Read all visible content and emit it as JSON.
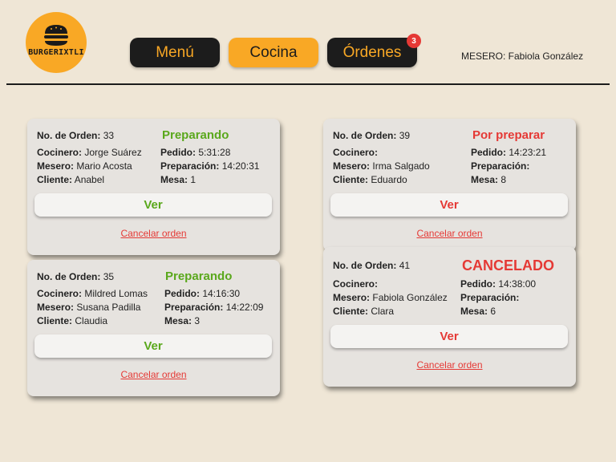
{
  "brand": {
    "name": "BURGERIXTLI"
  },
  "nav": {
    "menu_label": "Menú",
    "cocina_label": "Cocina",
    "ordenes_label": "Órdenes",
    "ordenes_badge": "3",
    "active": "Cocina"
  },
  "user": {
    "mesero_text": "MESERO: Fabiola González"
  },
  "labels": {
    "orden": "No. de Orden:",
    "cocinero": "Cocinero:",
    "mesero": "Mesero:",
    "cliente": "Cliente:",
    "pedido": "Pedido:",
    "preparacion": "Preparación:",
    "mesa": "Mesa:",
    "ver": "Ver",
    "cancelar": "Cancelar orden"
  },
  "orders": [
    {
      "numero": "33",
      "status": "Preparando",
      "cocinero": "Jorge Suárez",
      "mesero": "Mario Acosta",
      "cliente": "Anabel",
      "pedido": "5:31:28",
      "preparacion": "14:20:31",
      "mesa": "1"
    },
    {
      "numero": "35",
      "status": "Preparando",
      "cocinero": "Mildred Lomas",
      "mesero": "Susana Padilla",
      "cliente": "Claudia",
      "pedido": "14:16:30",
      "preparacion": "14:22:09",
      "mesa": "3"
    },
    {
      "numero": "39",
      "status": "Por preparar",
      "cocinero": "",
      "mesero": "Irma Salgado",
      "cliente": "Eduardo",
      "pedido": "14:23:21",
      "preparacion": "",
      "mesa": "8"
    },
    {
      "numero": "41",
      "status": "CANCELADO",
      "cocinero": "",
      "mesero": "Fabiola González",
      "cliente": "Clara",
      "pedido": "14:38:00",
      "preparacion": "",
      "mesa": "6"
    }
  ],
  "colors": {
    "accent": "#f9a825",
    "dark": "#1c1c1c",
    "green": "#5aa81c",
    "red": "#e53935",
    "background": "#efe6d6"
  }
}
